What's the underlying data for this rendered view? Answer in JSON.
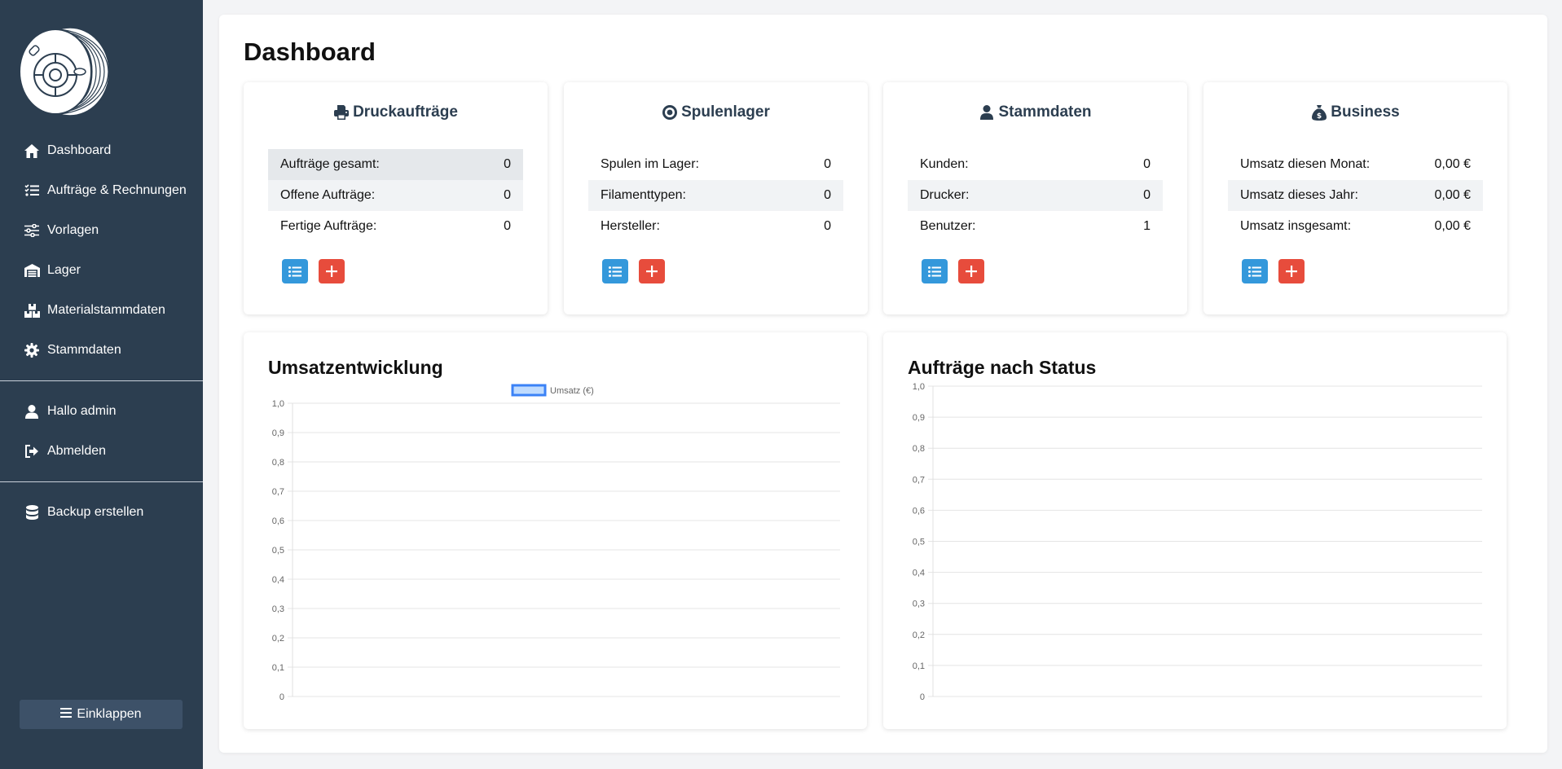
{
  "sidebar": {
    "nav": [
      {
        "label": "Dashboard",
        "icon": "home-icon"
      },
      {
        "label": "Aufträge & Rechnungen",
        "icon": "list-check-icon"
      },
      {
        "label": "Vorlagen",
        "icon": "sliders-icon"
      },
      {
        "label": "Lager",
        "icon": "warehouse-icon"
      },
      {
        "label": "Materialstammdaten",
        "icon": "boxes-icon"
      },
      {
        "label": "Stammdaten",
        "icon": "gear-icon"
      }
    ],
    "user_nav": [
      {
        "label": "Hallo admin",
        "icon": "user-icon"
      },
      {
        "label": "Abmelden",
        "icon": "sign-out-icon"
      }
    ],
    "backup_label": "Backup erstellen",
    "collapse_label": "Einklappen"
  },
  "page": {
    "title": "Dashboard"
  },
  "cards": [
    {
      "title": "Druckaufträge",
      "icon": "printer-icon",
      "rows": [
        {
          "label": "Aufträge gesamt:",
          "value": "0"
        },
        {
          "label": "Offene Aufträge:",
          "value": "0"
        },
        {
          "label": "Fertige Aufträge:",
          "value": "0"
        }
      ]
    },
    {
      "title": "Spulenlager",
      "icon": "spool-icon",
      "rows": [
        {
          "label": "Spulen im Lager:",
          "value": "0"
        },
        {
          "label": "Filamenttypen:",
          "value": "0"
        },
        {
          "label": "Hersteller:",
          "value": "0"
        }
      ]
    },
    {
      "title": "Stammdaten",
      "icon": "user-icon",
      "rows": [
        {
          "label": "Kunden:",
          "value": "0"
        },
        {
          "label": "Drucker:",
          "value": "0"
        },
        {
          "label": "Benutzer:",
          "value": "1"
        }
      ]
    },
    {
      "title": "Business",
      "icon": "money-bag-icon",
      "rows": [
        {
          "label": "Umsatz diesen Monat:",
          "value": "0,00 €"
        },
        {
          "label": "Umsatz dieses Jahr:",
          "value": "0,00 €"
        },
        {
          "label": "Umsatz insgesamt:",
          "value": "0,00 €"
        }
      ]
    }
  ],
  "colors": {
    "sidebar_bg": "#2c3e50",
    "list_button": "#3498db",
    "add_button": "#e74c3c",
    "series_line": "#3b82f6",
    "series_fill": "#bfdbfe"
  },
  "chart_data": [
    {
      "type": "line",
      "title": "Umsatzentwicklung",
      "categories": [],
      "series": [
        {
          "name": "Umsatz (€)",
          "values": []
        }
      ],
      "yticks": [
        "0",
        "0,1",
        "0,2",
        "0,3",
        "0,4",
        "0,5",
        "0,6",
        "0,7",
        "0,8",
        "0,9",
        "1,0"
      ],
      "ylim": [
        0,
        1
      ],
      "grid": true,
      "legend": "top-center"
    },
    {
      "type": "bar",
      "title": "Aufträge nach Status",
      "categories": [],
      "series": [],
      "yticks": [
        "0",
        "0,1",
        "0,2",
        "0,3",
        "0,4",
        "0,5",
        "0,6",
        "0,7",
        "0,8",
        "0,9",
        "1,0"
      ],
      "ylim": [
        0,
        1
      ],
      "grid": true
    }
  ]
}
